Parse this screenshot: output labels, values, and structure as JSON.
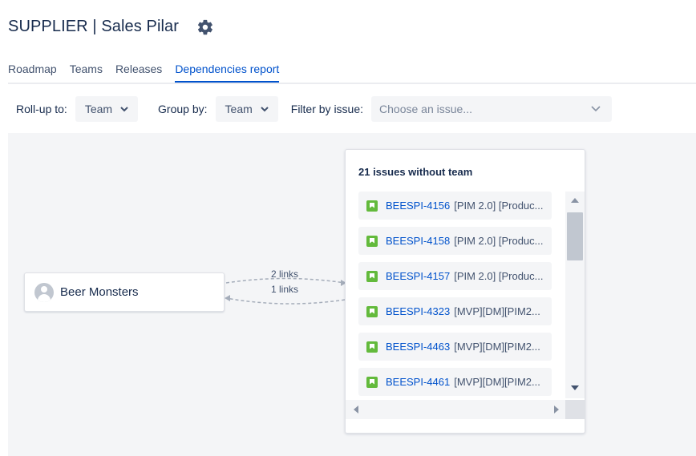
{
  "header": {
    "title": "SUPPLIER | Sales Pilar",
    "settings_icon": "gear-icon"
  },
  "tabs": [
    {
      "label": "Roadmap",
      "active": false
    },
    {
      "label": "Teams",
      "active": false
    },
    {
      "label": "Releases",
      "active": false
    },
    {
      "label": "Dependencies report",
      "active": true
    }
  ],
  "filters": {
    "rollup_label": "Roll-up to:",
    "rollup_value": "Team",
    "groupby_label": "Group by:",
    "groupby_value": "Team",
    "filter_label": "Filter by issue:",
    "issue_placeholder": "Choose an issue..."
  },
  "graph": {
    "team_node": {
      "name": "Beer Monsters",
      "icon": "avatar-icon"
    },
    "links": [
      {
        "label": "2 links"
      },
      {
        "label": "1 links"
      }
    ],
    "panel": {
      "title": "21 issues without team",
      "issues": [
        {
          "key": "BEESPI-4156",
          "summary": "[PIM 2.0] [Produc...",
          "type": "story"
        },
        {
          "key": "BEESPI-4158",
          "summary": "[PIM 2.0] [Produc...",
          "type": "story"
        },
        {
          "key": "BEESPI-4157",
          "summary": "[PIM 2.0] [Produc...",
          "type": "story"
        },
        {
          "key": "BEESPI-4323",
          "summary": "[MVP][DM][PIM2...",
          "type": "story"
        },
        {
          "key": "BEESPI-4463",
          "summary": "[MVP][DM][PIM2...",
          "type": "story"
        },
        {
          "key": "BEESPI-4461",
          "summary": "[MVP][DM][PIM2...",
          "type": "story"
        }
      ]
    }
  },
  "colors": {
    "accent": "#0052cc",
    "story": "#63ba3c",
    "canvas": "#f4f5f7",
    "text": "#172b4d"
  }
}
